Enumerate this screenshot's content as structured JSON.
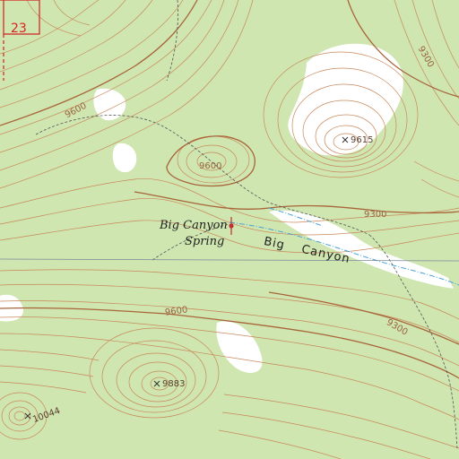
{
  "map": {
    "section_number": "23",
    "feature_labels": {
      "spring_line1": "Big Canyon",
      "spring_line2": "Spring",
      "canyon": "Big Canyon"
    },
    "contour_labels": [
      "9600",
      "9600",
      "9300",
      "9600",
      "9300",
      "9300"
    ],
    "spot_elevations": [
      "9615",
      "9883",
      "10044"
    ],
    "colors": {
      "vegetation": "#cfe6b0",
      "clearing": "#ffffff",
      "contour": "#c8885a",
      "index_contour": "#a8653a",
      "stream": "#4aa0d8",
      "section_line": "#d22222",
      "road_trail": "#555555",
      "feature_marker": "#c03030"
    },
    "icons": [
      "spot-elevation-x",
      "spring-marker"
    ]
  }
}
